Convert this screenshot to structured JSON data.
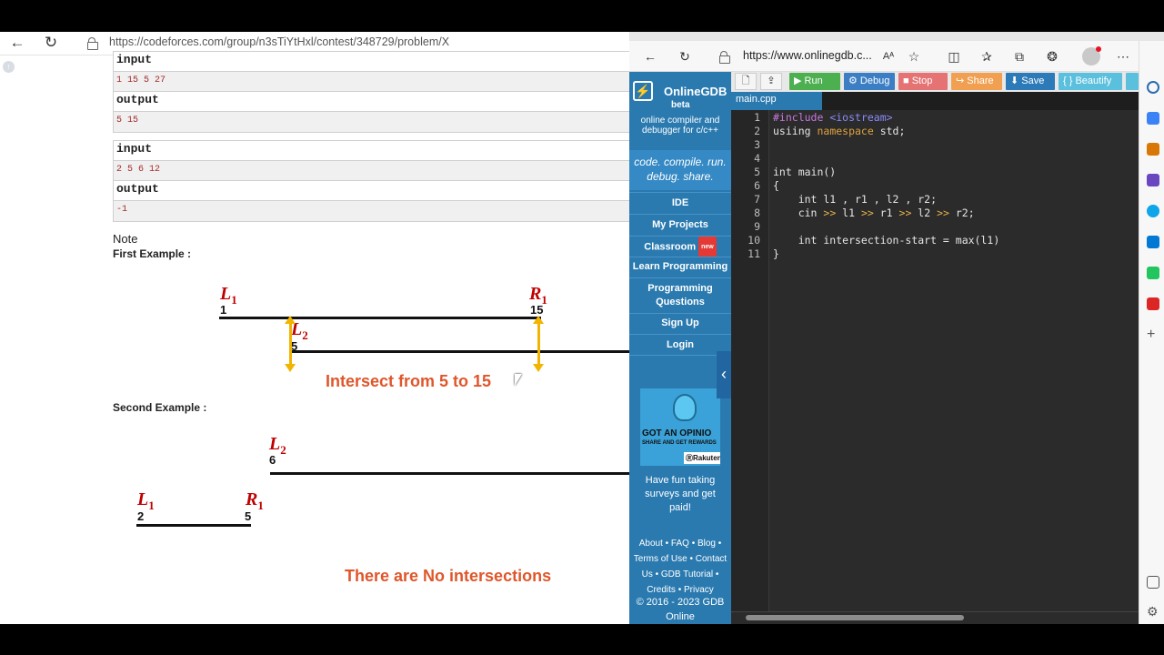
{
  "left_browser": {
    "url": "https://codeforces.com/group/n3sTiYtHxl/contest/348729/problem/X",
    "examples": [
      {
        "input_label": "input",
        "input_value": "1 15 5 27",
        "output_label": "output",
        "output_value": "5 15"
      },
      {
        "input_label": "input",
        "input_value": "2 5 6 12",
        "output_label": "output",
        "output_value": "-1"
      }
    ],
    "note": {
      "title": "Note",
      "first_example_label": "First Example :",
      "second_example_label": "Second Example :",
      "first_diagram": {
        "L1": "L",
        "L1_sub": "1",
        "L1_num": "1",
        "R1": "R",
        "R1_sub": "1",
        "R1_num": "15",
        "L2": "L",
        "L2_sub": "2",
        "L2_num": "5",
        "caption": "Intersect from 5 to 15"
      },
      "second_diagram": {
        "L2": "L",
        "L2_sub": "2",
        "L2_num": "6",
        "L1": "L",
        "L1_sub": "1",
        "L1_num": "2",
        "R1": "R",
        "R1_sub": "1",
        "R1_num": "5",
        "caption": "There are No intersections"
      }
    }
  },
  "right_browser": {
    "url": "https://www.onlinegdb.c...",
    "font_icon": "Aᴬ",
    "sidebar": {
      "brand": "OnlineGDB",
      "beta": "beta",
      "description": "online compiler and debugger for c/c++",
      "tagline": "code. compile. run. debug. share.",
      "items": [
        "IDE",
        "My Projects",
        "Classroom",
        "Learn Programming",
        "Programming Questions",
        "Sign Up",
        "Login"
      ],
      "new_badge": "new",
      "ad": {
        "line1": "GOT AN OPINIO",
        "line2": "SHARE AND GET REWARDS",
        "brand": "ⓇRakuten"
      },
      "ad_text": "Have fun taking surveys and get paid!",
      "footer_links": "About • FAQ • Blog • Terms of Use • Contact Us • GDB Tutorial • Credits • Privacy",
      "copyright": "© 2016 - 2023 GDB Online"
    },
    "toolbar": {
      "run": "▶ Run",
      "debug": "⚙ Debug",
      "stop": "■ Stop",
      "share": "↪ Share",
      "save": "⬇ Save",
      "beautify": "{ } Beautify"
    },
    "file_tab": "main.cpp",
    "code_lines": [
      {
        "n": "1",
        "text": ""
      },
      {
        "n": "2",
        "text": ""
      },
      {
        "n": "3",
        "text": ""
      },
      {
        "n": "4",
        "text": ""
      },
      {
        "n": "5",
        "text": "int main()"
      },
      {
        "n": "6",
        "text": "{"
      },
      {
        "n": "7",
        "text": "    int l1 , r1 , l2 , r2;"
      },
      {
        "n": "8",
        "text": ""
      },
      {
        "n": "9",
        "text": ""
      },
      {
        "n": "10",
        "text": ""
      },
      {
        "n": "11",
        "text": "}"
      }
    ],
    "code_line1": {
      "pp": "#include",
      "inc": "<iostream>"
    },
    "code_line2": {
      "a": "usiing ",
      "ns": "namespace",
      "b": " std;"
    },
    "code_line8": {
      "a": "    cin ",
      "o1": ">>",
      "b": " l1 ",
      "o2": ">>",
      "c": " r1 ",
      "o3": ">>",
      "d": " l2 ",
      "o4": ">>",
      "e": " r2;"
    },
    "code_line10": {
      "a": "    int intersection-start = max(l1)"
    },
    "colors": {
      "gdb_blue": "#2a7ab0",
      "run": "#4caf50",
      "debug": "#3b7ec4",
      "stop": "#e57373",
      "share": "#f0a050",
      "save": "#2c7ab8",
      "beautify": "#5bc0de"
    }
  }
}
